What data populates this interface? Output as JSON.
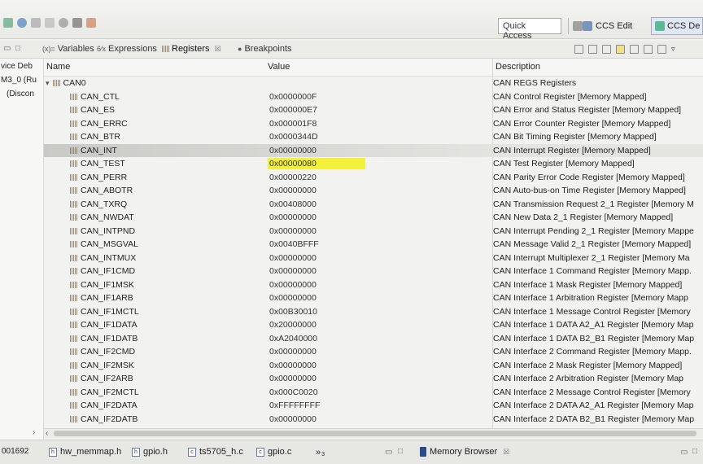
{
  "toolbar": {
    "quick_access": "Quick Access",
    "ccs_edit": "CCS Edit",
    "ccs_debug": "CCS De"
  },
  "tabs": [
    {
      "label": "Variables",
      "icon": "variables-icon"
    },
    {
      "label": "Expressions",
      "icon": "expressions-icon"
    },
    {
      "label": "Registers",
      "icon": "registers-icon",
      "selected": true,
      "close": "☒"
    },
    {
      "label": "Breakpoints",
      "icon": "breakpoints-icon"
    }
  ],
  "left_panel": {
    "lines": [
      "vice Deb",
      "M3_0 (Ru",
      "(Discon"
    ],
    "bottom_text": "001692"
  },
  "columns": {
    "name": "Name",
    "value": "Value",
    "description": "Description"
  },
  "root": {
    "name": "CAN0",
    "description": "CAN REGS Registers"
  },
  "registers": [
    {
      "name": "CAN_CTL",
      "value": "0x0000000F",
      "description": "CAN Control Register [Memory Mapped]"
    },
    {
      "name": "CAN_ES",
      "value": "0x000000E7",
      "description": "CAN Error and Status Register [Memory Mapped]"
    },
    {
      "name": "CAN_ERRC",
      "value": "0x000001F8",
      "description": "CAN Error Counter Register [Memory Mapped]"
    },
    {
      "name": "CAN_BTR",
      "value": "0x0000344D",
      "description": "CAN Bit Timing Register [Memory Mapped]"
    },
    {
      "name": "CAN_INT",
      "value": "0x00000000",
      "description": "CAN Interrupt Register [Memory Mapped]",
      "selected": true
    },
    {
      "name": "CAN_TEST",
      "value": "0x00000080",
      "description": "CAN Test Register [Memory Mapped]",
      "highlight": true
    },
    {
      "name": "CAN_PERR",
      "value": "0x00000220",
      "description": "CAN Parity Error Code Register [Memory Mapped]"
    },
    {
      "name": "CAN_ABOTR",
      "value": "0x00000000",
      "description": "CAN Auto-bus-on Time Register [Memory Mapped]"
    },
    {
      "name": "CAN_TXRQ",
      "value": "0x00408000",
      "description": "CAN Transmission Request 2_1 Register [Memory M"
    },
    {
      "name": "CAN_NWDAT",
      "value": "0x00000000",
      "description": "CAN New Data 2_1 Register [Memory Mapped]"
    },
    {
      "name": "CAN_INTPND",
      "value": "0x00000000",
      "description": "CAN Interrupt Pending 2_1 Register [Memory Mappe"
    },
    {
      "name": "CAN_MSGVAL",
      "value": "0x0040BFFF",
      "description": "CAN Message Valid 2_1 Register [Memory Mapped]"
    },
    {
      "name": "CAN_INTMUX",
      "value": "0x00000000",
      "description": "CAN Interrupt Multiplexer 2_1 Register [Memory Ma"
    },
    {
      "name": "CAN_IF1CMD",
      "value": "0x00000000",
      "description": "CAN Interface 1 Command Register [Memory Mapp."
    },
    {
      "name": "CAN_IF1MSK",
      "value": "0x00000000",
      "description": "CAN Interface 1 Mask Register [Memory Mapped]"
    },
    {
      "name": "CAN_IF1ARB",
      "value": "0x00000000",
      "description": "CAN Interface 1 Arbitration Register [Memory Mapp"
    },
    {
      "name": "CAN_IF1MCTL",
      "value": "0x00B30010",
      "description": "CAN Interface 1 Message Control Register [Memory"
    },
    {
      "name": "CAN_IF1DATA",
      "value": "0x20000000",
      "description": "CAN Interface 1 DATA A2_A1 Register [Memory Map"
    },
    {
      "name": "CAN_IF1DATB",
      "value": "0xA2040000",
      "description": "CAN Interface 1 DATA B2_B1 Register [Memory Map"
    },
    {
      "name": "CAN_IF2CMD",
      "value": "0x00000000",
      "description": "CAN Interface 2 Command Register [Memory Mapp."
    },
    {
      "name": "CAN_IF2MSK",
      "value": "0x00000000",
      "description": "CAN Interface 2 Mask Register [Memory Mapped]"
    },
    {
      "name": "CAN_IF2ARB",
      "value": "0x00000000",
      "description": "CAN Interface 2 Arbitration Register [Memory Map"
    },
    {
      "name": "CAN_IF2MCTL",
      "value": "0x000C0020",
      "description": "CAN Interface 2 Message Control Register [Memory"
    },
    {
      "name": "CAN_IF2DATA",
      "value": "0xFFFFFFFF",
      "description": "CAN Interface 2 DATA A2_A1 Register [Memory Map"
    },
    {
      "name": "CAN_IF2DATB",
      "value": "0x00000000",
      "description": "CAN Interface 2 DATA B2_B1 Register [Memory Map"
    }
  ],
  "bottom_tabs": [
    {
      "label": "hw_memmap.h",
      "icon": "h-file-icon"
    },
    {
      "label": "gpio.h",
      "icon": "h-file-icon"
    },
    {
      "label": "ts5705_h.c",
      "icon": "c-file-icon"
    },
    {
      "label": "gpio.c",
      "icon": "c-file-icon"
    },
    {
      "label": "»",
      "sub": "3"
    }
  ],
  "memory_browser": {
    "label": "Memory Browser",
    "close": "☒"
  },
  "colors": {
    "highlight": "#f3f03a",
    "selected_row": "#c9c9c6"
  }
}
